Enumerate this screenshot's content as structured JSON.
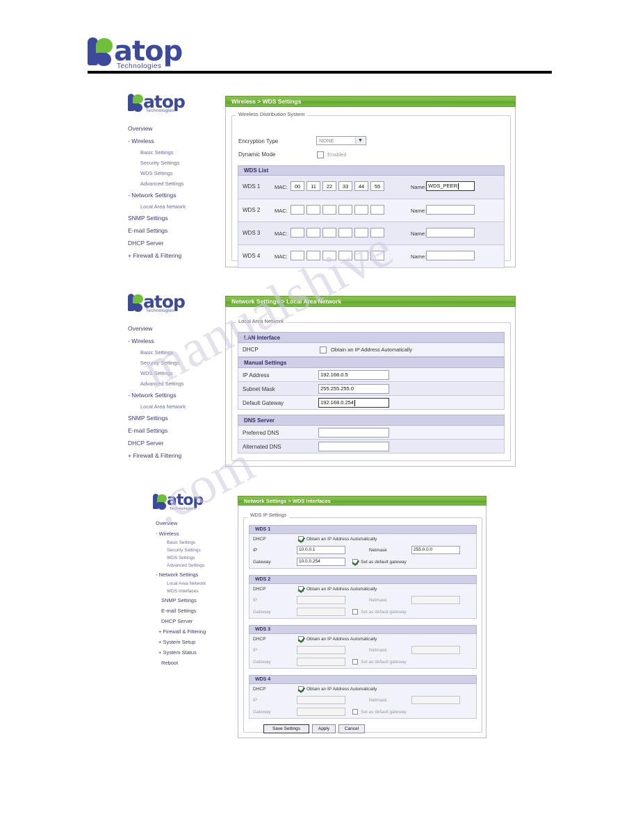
{
  "document": {
    "brand": {
      "name": "atop",
      "tagline": "Technologies"
    }
  },
  "watermark": {
    "line1": "manualshive",
    "line2": ".com"
  },
  "screens": [
    {
      "id": "wds-settings",
      "title": "Wireless > WDS Settings",
      "menu": {
        "brand": "atop",
        "brand_sub": "Technologies",
        "items": [
          {
            "label": "Overview",
            "level": "top"
          },
          {
            "label": "- Wireless",
            "level": "top"
          },
          {
            "label": "Basic Settings",
            "level": "sub"
          },
          {
            "label": "Security Settings",
            "level": "sub"
          },
          {
            "label": "WDS Settings",
            "level": "sub"
          },
          {
            "label": "Advanced Settings",
            "level": "sub"
          },
          {
            "label": "- Network Settings",
            "level": "top"
          },
          {
            "label": "Local Area Network",
            "level": "sub"
          },
          {
            "label": "SNMP Settings",
            "level": "top"
          },
          {
            "label": "E-mail Settings",
            "level": "top"
          },
          {
            "label": "DHCP Server",
            "level": "top"
          },
          {
            "label": "+ Firewall & Filtering",
            "level": "top"
          }
        ]
      },
      "fieldset": "Wireless Distribution System",
      "fields": {
        "encryption_type_label": "Encryption Type",
        "encryption_type_value": "NONE",
        "dynamic_mode_label": "Dynamic Mode",
        "dynamic_mode_checkbox_label": "Enabled",
        "dynamic_mode_checked": false
      },
      "wds_list_title": "WDS List",
      "name_label": "Name:",
      "mac_label": "MAC:",
      "wds_rows": [
        {
          "label": "WDS 1",
          "mac": [
            "00",
            "11",
            "22",
            "33",
            "44",
            "55"
          ],
          "name": "WDS_PEER"
        },
        {
          "label": "WDS 2",
          "mac": [
            "",
            "",
            "",
            "",
            "",
            ""
          ],
          "name": ""
        },
        {
          "label": "WDS 3",
          "mac": [
            "",
            "",
            "",
            "",
            "",
            ""
          ],
          "name": ""
        },
        {
          "label": "WDS 4",
          "mac": [
            "",
            "",
            "",
            "",
            "",
            ""
          ],
          "name": ""
        }
      ]
    },
    {
      "id": "local-area-network",
      "title": "Network Settings > Local Area Network",
      "menu": {
        "brand": "atop",
        "brand_sub": "Technologies",
        "items": [
          {
            "label": "Overview",
            "level": "top"
          },
          {
            "label": "- Wireless",
            "level": "top"
          },
          {
            "label": "Basic Settings",
            "level": "sub"
          },
          {
            "label": "Security Settings",
            "level": "sub"
          },
          {
            "label": "WDS Settings",
            "level": "sub"
          },
          {
            "label": "Advanced Settings",
            "level": "sub"
          },
          {
            "label": "- Network Settings",
            "level": "top"
          },
          {
            "label": "Local Area Network",
            "level": "sub"
          },
          {
            "label": "SNMP Settings",
            "level": "top"
          },
          {
            "label": "E-mail Settings",
            "level": "top"
          },
          {
            "label": "DHCP Server",
            "level": "top"
          },
          {
            "label": "+ Firewall & Filtering",
            "level": "top"
          }
        ]
      },
      "fieldset": "Local Area Network",
      "sections": [
        {
          "title": "LAN Interface"
        },
        {
          "title": "Manual Settings"
        },
        {
          "title": "DNS Server"
        }
      ],
      "rows": [
        {
          "label": "DHCP",
          "type": "checkbox",
          "checkbox_label": "Obtain an IP Address Automatically",
          "checked": false
        },
        {
          "label": "IP Address",
          "type": "text",
          "value": "192.168.0.5"
        },
        {
          "label": "Subnet Mask",
          "type": "text",
          "value": "255.255.255.0"
        },
        {
          "label": "Default Gateway",
          "type": "text",
          "value": "192.168.0.254"
        },
        {
          "label": "Preferred DNS",
          "type": "text",
          "value": ""
        },
        {
          "label": "Alternated DNS",
          "type": "text",
          "value": ""
        }
      ]
    },
    {
      "id": "wds-interfaces",
      "title": "Network Settings > WDS Interfaces",
      "menu": {
        "brand": "atop",
        "brand_sub": "Technologies",
        "items": [
          {
            "label": "Overview",
            "level": "top"
          },
          {
            "label": "- Wireless",
            "level": "top"
          },
          {
            "label": "Basic Settings",
            "level": "sub"
          },
          {
            "label": "Security Settings",
            "level": "sub"
          },
          {
            "label": "WDS Settings",
            "level": "sub"
          },
          {
            "label": "Advanced Settings",
            "level": "sub"
          },
          {
            "label": "- Network Settings",
            "level": "top"
          },
          {
            "label": "Local Area Network",
            "level": "sub"
          },
          {
            "label": "WDS Interfaces",
            "level": "sub"
          },
          {
            "label": "SNMP Settings",
            "level": "top"
          },
          {
            "label": "E-mail Settings",
            "level": "top"
          },
          {
            "label": "DHCP Server",
            "level": "top"
          },
          {
            "label": "+ Firewall & Filtering",
            "level": "top"
          },
          {
            "label": "+ System Setup",
            "level": "top"
          },
          {
            "label": "+ System Status",
            "level": "top"
          },
          {
            "label": "Reboot",
            "level": "top"
          }
        ]
      },
      "fieldset": "WDS IP Settings",
      "labels": {
        "dhcp": "DHCP",
        "dhcp_checkbox": "Obtain an IP Address Automatically",
        "ip": "IP",
        "netmask": "Netmask",
        "gateway": "Gateway",
        "default_gateway_checkbox": "Set as default gateway"
      },
      "groups": [
        {
          "title": "WDS 1",
          "dhcp_checked": true,
          "ip": "10.0.0.1",
          "netmask": "255.0.0.0",
          "gateway": "10.0.0.254",
          "default_gw_checked": true,
          "disabled": false
        },
        {
          "title": "WDS 2",
          "dhcp_checked": true,
          "ip": "",
          "netmask": "",
          "gateway": "",
          "default_gw_checked": false,
          "disabled": true
        },
        {
          "title": "WDS 3",
          "dhcp_checked": true,
          "ip": "",
          "netmask": "",
          "gateway": "",
          "default_gw_checked": false,
          "disabled": true
        },
        {
          "title": "WDS 4",
          "dhcp_checked": true,
          "ip": "",
          "netmask": "",
          "gateway": "",
          "default_gw_checked": false,
          "disabled": true
        }
      ],
      "buttons": [
        {
          "label": "Save Settings"
        },
        {
          "label": "Apply"
        },
        {
          "label": "Cancel"
        }
      ]
    }
  ],
  "colors": {
    "green_bar": "#76b83c",
    "section": "#cfcfe8",
    "brand_blue": "#3b4a9b",
    "brand_green": "#6fbf3a"
  }
}
